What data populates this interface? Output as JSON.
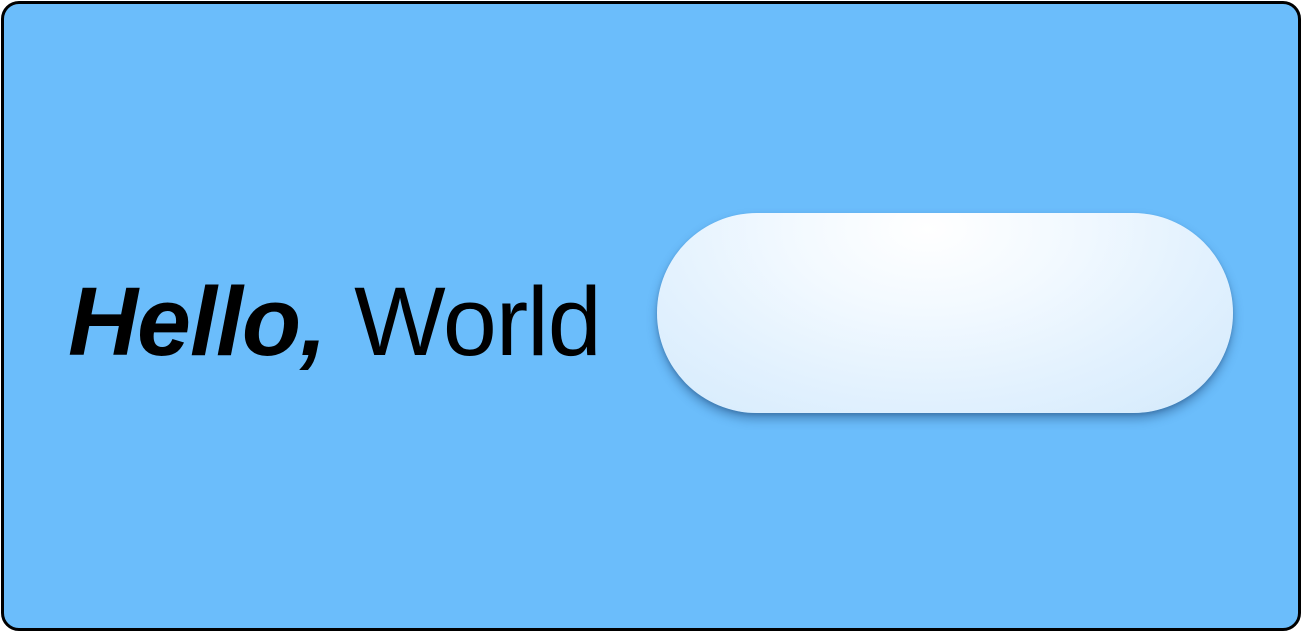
{
  "greeting": {
    "bold_text": "Hello,",
    "regular_text": "World"
  },
  "button": {
    "label": ""
  },
  "colors": {
    "background": "#6bbdfb",
    "border": "#000000",
    "text": "#000000",
    "button_highlight": "#ffffff",
    "button_edge": "#d6ebfc"
  }
}
